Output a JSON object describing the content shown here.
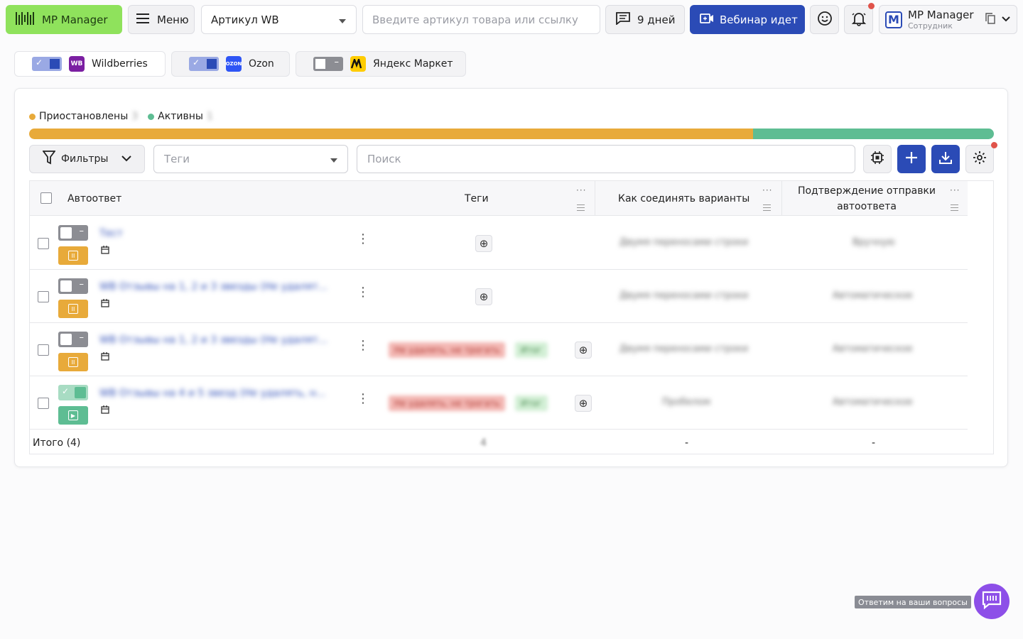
{
  "topbar": {
    "logo_text": "MP Manager",
    "menu_label": "Меню",
    "article_select": "Артикул WB",
    "article_search_placeholder": "Введите артикул товара или ссылку",
    "days_label": "9 дней",
    "webinar_label": "Вебинар идет",
    "user": {
      "initial": "M",
      "name": "MP Manager",
      "role": "Сотрудник"
    }
  },
  "marketplaces": [
    {
      "label": "Wildberries",
      "logo": "WB",
      "enabled": true,
      "logo_color": "#7b1fa2"
    },
    {
      "label": "Ozon",
      "logo": "OZON",
      "enabled": true,
      "logo_color": "#2e55f5"
    },
    {
      "label": "Яндекс Маркет",
      "logo": "YM",
      "enabled": false,
      "logo_color": "#ffcc00"
    }
  ],
  "legend": {
    "paused_label": "Приостановлены",
    "paused_count": "3",
    "active_label": "Активны",
    "active_count": "1"
  },
  "progress": {
    "paused_fraction": 0.75,
    "active_fraction": 0.25
  },
  "toolbar": {
    "filters_label": "Фильтры",
    "tags_placeholder": "Теги",
    "search_placeholder": "Поиск"
  },
  "table": {
    "columns": {
      "autoresponse": "Автоответ",
      "tags": "Теги",
      "combine": "Как соединять варианты",
      "confirm": "Подтверждение отправки автоответа"
    },
    "rows": [
      {
        "name": "Тест",
        "enabled": false,
        "status": "paused",
        "tags": [],
        "combine": "Двумя переносами строки",
        "confirm": "Вручную"
      },
      {
        "name": "WB Отзывы на 1, 2 и 3 звезды (Не удалят...",
        "enabled": false,
        "status": "paused",
        "tags": [],
        "combine": "Двумя переносами строки",
        "confirm": "Автоматическое"
      },
      {
        "name": "WB Отзывы на 1, 2 и 3 звезды (Не удалят...",
        "enabled": false,
        "status": "paused",
        "tags": [
          "Не удалять, не трогать",
          "Итог"
        ],
        "combine": "Двумя переносами строки",
        "confirm": "Автоматическое"
      },
      {
        "name": "WB Отзывы на 4 и 5 звезд (Не удалять, н...",
        "enabled": true,
        "status": "active",
        "tags": [
          "Не удалять, не трогать",
          "Итог"
        ],
        "combine": "Пробелом",
        "confirm": "Автоматическое"
      }
    ],
    "total_label": "Итого (4)",
    "total_tags": "4",
    "total_combine": "-",
    "total_confirm": "-"
  },
  "chat": {
    "label": "Ответим на ваши вопросы"
  },
  "colors": {
    "paused": "#e8aa3a",
    "active": "#5ebd93",
    "primary": "#2b4bb6",
    "logo_bg": "#8fe25c",
    "chat": "#8d4fe8"
  }
}
